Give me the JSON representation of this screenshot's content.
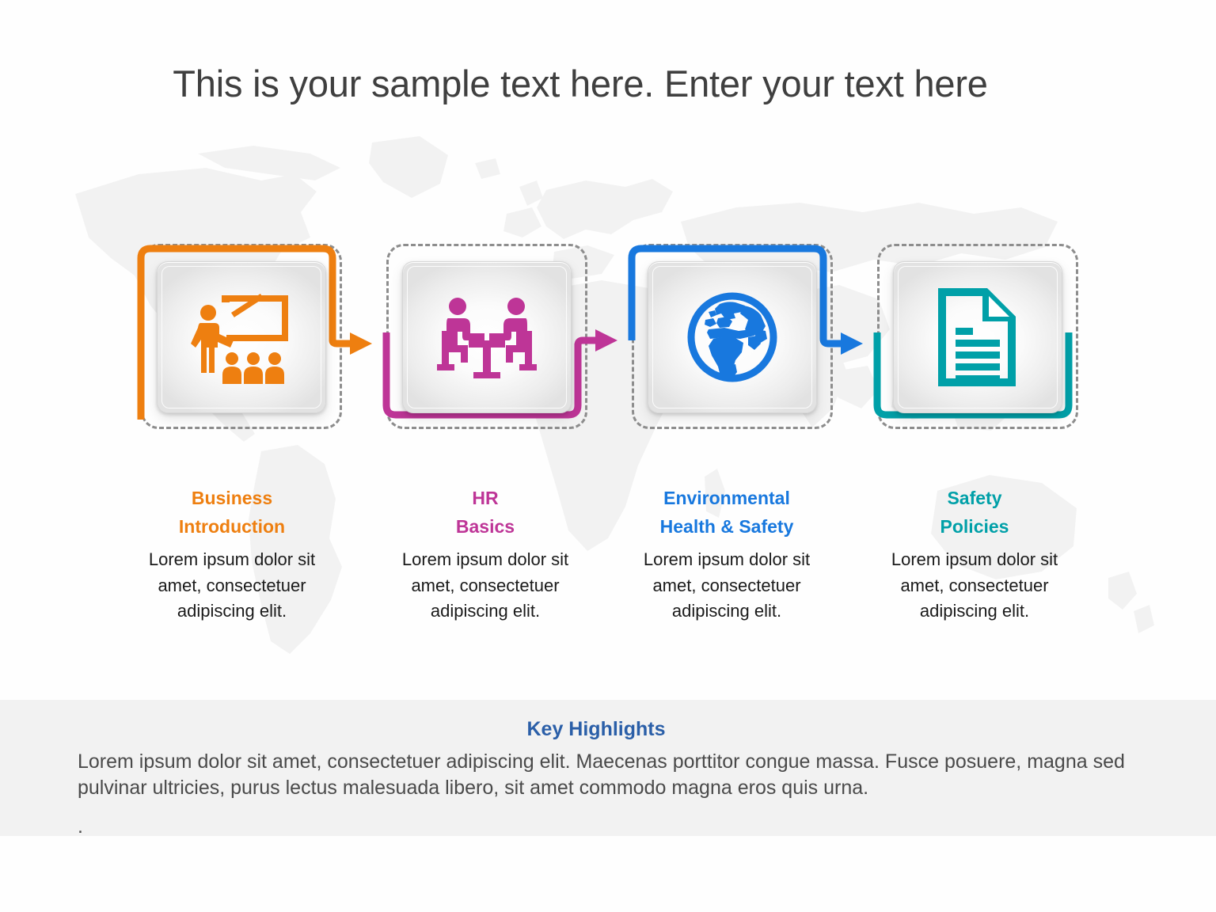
{
  "title": "This is your sample text here. Enter your text here",
  "colors": {
    "orange": "#EE7F10",
    "magenta": "#BE3597",
    "blue": "#1878DE",
    "teal": "#00A0A8",
    "title_text": "#3F3F3F",
    "body_text": "#1A1A1A",
    "footer_title": "#2B5FA8",
    "footer_bg": "#F2F2F2",
    "dashed_border": "#8D8D8D"
  },
  "steps": [
    {
      "icon": "presenter-classroom-icon",
      "heading_line1": "Business",
      "heading_line2": "Introduction",
      "description": "Lorem ipsum dolor sit amet, consectetuer adipiscing elit.",
      "color": "#EE7F10"
    },
    {
      "icon": "people-meeting-table-icon",
      "heading_line1": "HR",
      "heading_line2": "Basics",
      "description": "Lorem ipsum dolor sit amet, consectetuer adipiscing elit.",
      "color": "#BE3597"
    },
    {
      "icon": "globe-icon",
      "heading_line1": "Environmental",
      "heading_line2": "Health & Safety",
      "description": "Lorem ipsum dolor sit amet, consectetuer adipiscing elit.",
      "color": "#1878DE"
    },
    {
      "icon": "document-icon",
      "heading_line1": "Safety",
      "heading_line2": "Policies",
      "description": "Lorem ipsum dolor sit amet, consectetuer adipiscing elit.",
      "color": "#00A0A8"
    }
  ],
  "footer": {
    "title": "Key Highlights",
    "body": "Lorem ipsum dolor sit amet, consectetuer adipiscing elit. Maecenas porttitor congue massa. Fusce posuere, magna sed pulvinar ultricies, purus lectus malesuada libero, sit amet commodo magna eros quis urna.",
    "trailing_mark": "."
  }
}
